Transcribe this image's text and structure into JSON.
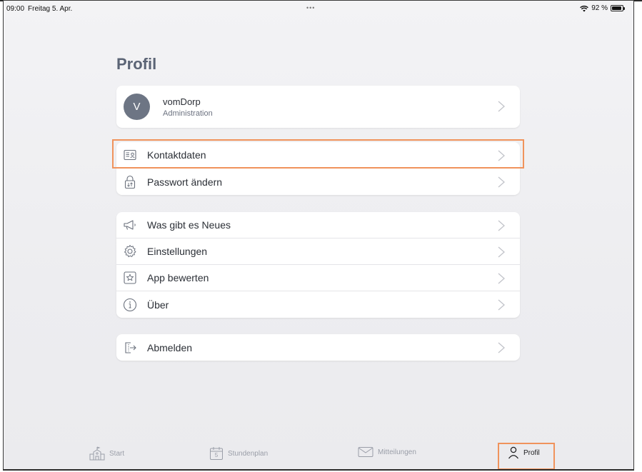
{
  "status_bar": {
    "time": "09:00",
    "date": "Freitag 5. Apr.",
    "dots": "•••",
    "battery": "92 %",
    "battery_level": 0.92
  },
  "page": {
    "title": "Profil"
  },
  "profile": {
    "initial": "V",
    "name": "vomDorp",
    "role": "Administration"
  },
  "account_section": [
    {
      "label": "Kontaktdaten",
      "icon": "contact-card-icon"
    },
    {
      "label": "Passwort ändern",
      "icon": "lock-icon"
    }
  ],
  "info_section": [
    {
      "label": "Was gibt es Neues",
      "icon": "megaphone-icon"
    },
    {
      "label": "Einstellungen",
      "icon": "gear-icon"
    },
    {
      "label": "App bewerten",
      "icon": "star-icon"
    },
    {
      "label": "Über",
      "icon": "info-icon"
    }
  ],
  "logout": {
    "label": "Abmelden",
    "icon": "logout-icon"
  },
  "tabs": [
    {
      "label": "Start",
      "icon": "school-icon",
      "active": false
    },
    {
      "label": "Stundenplan",
      "icon": "calendar-icon",
      "active": false,
      "calendar_day": "5"
    },
    {
      "label": "Mitteilungen",
      "icon": "mail-icon",
      "active": false
    },
    {
      "label": "Profil",
      "icon": "person-icon",
      "active": true
    }
  ],
  "colors": {
    "highlight": "#f0935c",
    "title": "#5b6475",
    "avatar": "#6d7584"
  }
}
